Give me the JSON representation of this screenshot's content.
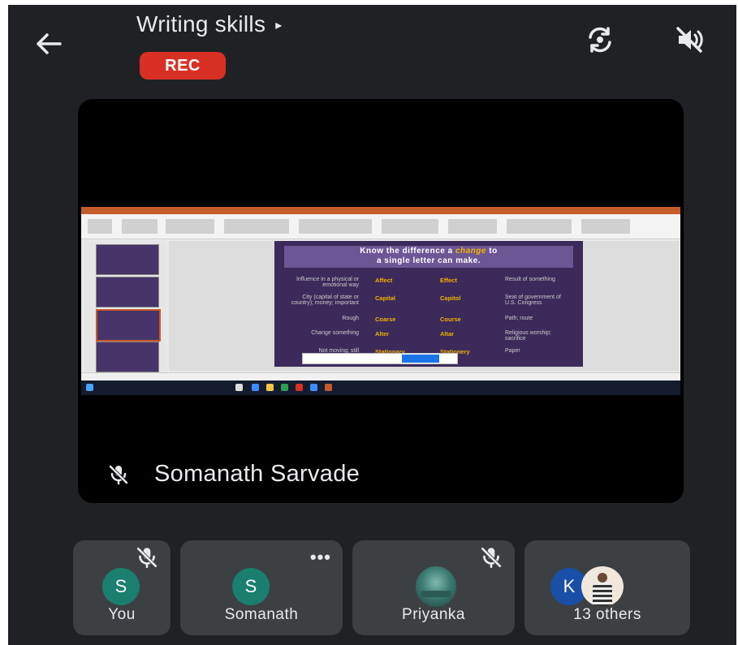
{
  "header": {
    "title": "Writing skills",
    "title_caret": "▸",
    "rec_label": "REC"
  },
  "shared_screen": {
    "slide_title_line1_a": "Know the difference a ",
    "slide_title_line1_b": "change",
    "slide_title_line1_c": " to",
    "slide_title_line2": "a single letter can make.",
    "rows": [
      {
        "left": "Influence in a physical or emotional way",
        "w1": "Affect",
        "w2": "Effect",
        "right": "Result of something"
      },
      {
        "left": "City (capital of state or country); money; important",
        "w1": "Capital",
        "w2": "Capitol",
        "right": "Seat of government of U.S. Congress"
      },
      {
        "left": "Rough",
        "w1": "Coarse",
        "w2": "Course",
        "right": "Path; route"
      },
      {
        "left": "Change something",
        "w1": "Alter",
        "w2": "Altar",
        "right": "Religious worship; sacrifice"
      },
      {
        "left": "Not moving; still",
        "w1": "Stationary",
        "w2": "Stationery",
        "right": "Paper"
      }
    ]
  },
  "presenter": {
    "name": "Somanath Sarvade"
  },
  "participants": [
    {
      "initial": "S",
      "label": "You",
      "muted": true
    },
    {
      "initial": "S",
      "label": "Somanath",
      "menu": "•••"
    },
    {
      "initial": "",
      "label": "Priyanka",
      "muted": true
    },
    {
      "initial": "K",
      "label": "13 others"
    }
  ],
  "colors": {
    "background": "#202124",
    "tile": "#3c4043",
    "rec": "#d93025",
    "avatar_s": "#1a7f6e",
    "avatar_k": "#1a4fa8"
  }
}
